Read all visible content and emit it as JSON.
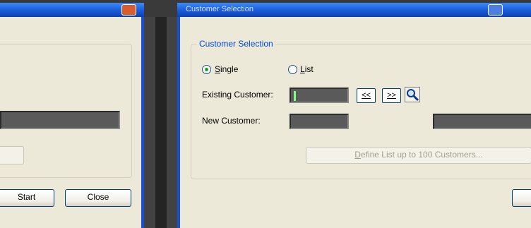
{
  "left_window": {
    "buttons": {
      "start": "Start",
      "close": "Close"
    }
  },
  "right_window": {
    "title": "Customer Selection",
    "group_title": "Customer Selection",
    "radio_single": {
      "prefix": "",
      "mnemonic": "S",
      "rest": "ingle",
      "checked": true
    },
    "radio_list": {
      "prefix": "",
      "mnemonic": "L",
      "rest": "ist",
      "checked": false
    },
    "existing_customer_label": "Existing Customer:",
    "existing_customer_value": "",
    "prev_button": "<<",
    "next_button": ">>",
    "new_customer_label": "New Customer:",
    "new_customer_value": "",
    "define_list_mnemonic": "D",
    "define_list_rest": "efine List up to 100 Customers..."
  },
  "icons": {
    "search": "magnifier-icon",
    "close": "close-icon"
  }
}
